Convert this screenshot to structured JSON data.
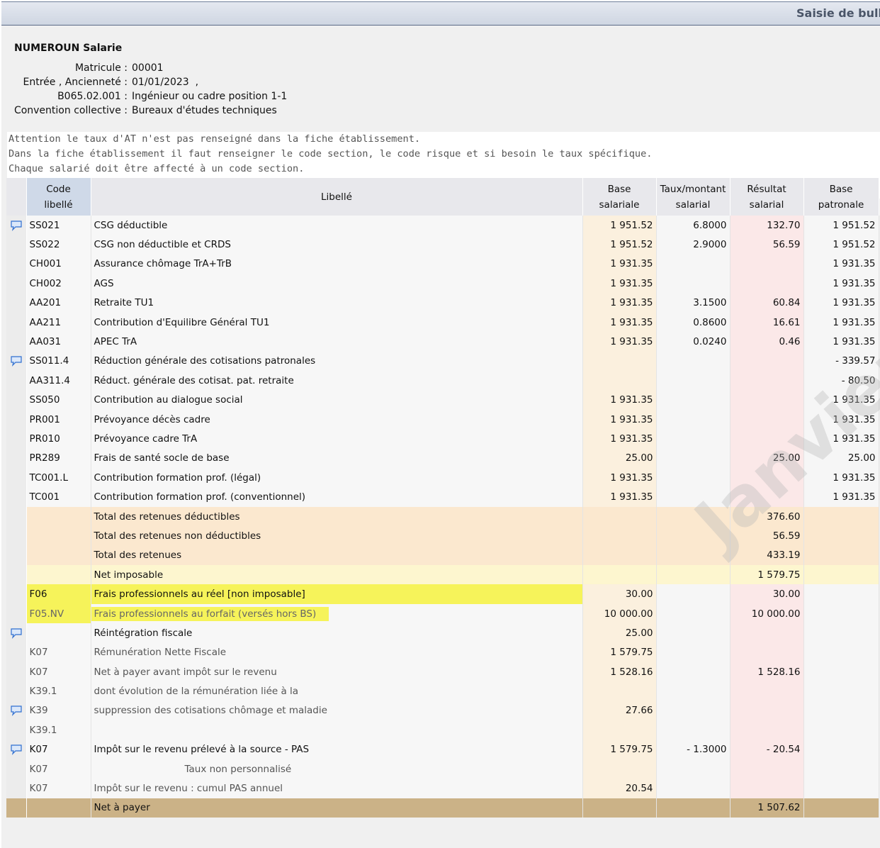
{
  "window": {
    "title": "Saisie de bulletin"
  },
  "employee": {
    "name": "NUMEROUN Salarie",
    "fields": [
      {
        "label": "Matricule :",
        "value": "00001"
      },
      {
        "label": "Entrée , Ancienneté :",
        "value": "01/01/2023  ,"
      },
      {
        "label": "B065.02.001 :",
        "value": "Ingénieur ou cadre position 1-1"
      },
      {
        "label": "Convention collective :",
        "value": "Bureaux d'études techniques"
      }
    ]
  },
  "warning": {
    "lines": [
      "Attention le taux d'AT n'est pas renseigné dans la fiche établissement.",
      "Dans la fiche établissement il faut renseigner le code section, le code risque et si besoin le taux spécifique.",
      "Chaque salarié doit être affecté à un code section."
    ]
  },
  "table": {
    "headers": {
      "code_1": "Code",
      "code_2": "libellé",
      "libelle": "Libellé",
      "base_sal_1": "Base",
      "base_sal_2": "salariale",
      "taux_1": "Taux/montant",
      "taux_2": "salarial",
      "res_1": "Résultat",
      "res_2": "salarial",
      "base_pat_1": "Base",
      "base_pat_2": "patronale"
    },
    "rows": [
      {
        "code": "SS021",
        "label": "CSG déductible",
        "base": "1 951.52",
        "taux": "6.8000",
        "result": "132.70",
        "patr": "1 951.52",
        "comment": true
      },
      {
        "code": "SS022",
        "label": "CSG non déductible et CRDS",
        "base": "1 951.52",
        "taux": "2.9000",
        "result": "56.59",
        "patr": "1 951.52"
      },
      {
        "code": "CH001",
        "label": "Assurance chômage TrA+TrB",
        "base": "1 931.35",
        "taux": "",
        "result": "",
        "patr": "1 931.35"
      },
      {
        "code": "CH002",
        "label": "AGS",
        "base": "1 931.35",
        "taux": "",
        "result": "",
        "patr": "1 931.35"
      },
      {
        "code": "AA201",
        "label": "Retraite TU1",
        "base": "1 931.35",
        "taux": "3.1500",
        "result": "60.84",
        "patr": "1 931.35"
      },
      {
        "code": "AA211",
        "label": "Contribution d'Equilibre Général TU1",
        "base": "1 931.35",
        "taux": "0.8600",
        "result": "16.61",
        "patr": "1 931.35"
      },
      {
        "code": "AA031",
        "label": "APEC TrA",
        "base": "1 931.35",
        "taux": "0.0240",
        "result": "0.46",
        "patr": "1 931.35"
      },
      {
        "code": "SS011.4",
        "label": "Réduction générale des cotisations patronales",
        "base": "",
        "taux": "",
        "result": "",
        "patr": "- 339.57",
        "comment": true
      },
      {
        "code": "AA311.4",
        "label": "Réduct. générale des cotisat. pat. retraite",
        "base": "",
        "taux": "",
        "result": "",
        "patr": "- 80.50"
      },
      {
        "code": "SS050",
        "label": "Contribution au dialogue social",
        "base": "1 931.35",
        "taux": "",
        "result": "",
        "patr": "1 931.35"
      },
      {
        "code": "PR001",
        "label": "Prévoyance décès cadre",
        "base": "1 931.35",
        "taux": "",
        "result": "",
        "patr": "1 931.35"
      },
      {
        "code": "PR010",
        "label": "Prévoyance cadre TrA",
        "base": "1 931.35",
        "taux": "",
        "result": "",
        "patr": "1 931.35"
      },
      {
        "code": "PR289",
        "label": "Frais de santé socle de base",
        "base": "25.00",
        "taux": "",
        "result": "25.00",
        "patr": "25.00"
      },
      {
        "code": "TC001.L",
        "label": "Contribution formation prof. (légal)",
        "base": "1 931.35",
        "taux": "",
        "result": "",
        "patr": "1 931.35"
      },
      {
        "code": "TC001",
        "label": "Contribution formation prof. (conventionnel)",
        "base": "1 931.35",
        "taux": "",
        "result": "",
        "patr": "1 931.35"
      },
      {
        "code": "",
        "label": "Total des retenues déductibles",
        "base": "",
        "taux": "",
        "result": "376.60",
        "patr": "",
        "style": "tot"
      },
      {
        "code": "",
        "label": "Total des retenues non déductibles",
        "base": "",
        "taux": "",
        "result": "56.59",
        "patr": "",
        "style": "tot"
      },
      {
        "code": "",
        "label": "Total des retenues",
        "base": "",
        "taux": "",
        "result": "433.19",
        "patr": "",
        "style": "tot"
      },
      {
        "code": "",
        "label": "Net imposable",
        "base": "",
        "taux": "",
        "result": "1 579.75",
        "patr": "",
        "style": "net"
      },
      {
        "code": "F06",
        "label": "Frais professionnels au réel [non imposable]",
        "base": "30.00",
        "taux": "",
        "result": "30.00",
        "patr": "",
        "style": "hl"
      },
      {
        "code": "F05.NV",
        "label": "Frais professionnels au forfait (versés hors BS)",
        "base": "10 000.00",
        "taux": "",
        "result": "10 000.00",
        "patr": "",
        "style": "hl2"
      },
      {
        "code": "",
        "label": "Réintégration fiscale",
        "base": "25.00",
        "taux": "",
        "result": "",
        "patr": "",
        "comment": true
      },
      {
        "code": "K07",
        "label": "Rémunération Nette Fiscale",
        "base": "1 579.75",
        "taux": "",
        "result": "",
        "patr": "",
        "style": "grey"
      },
      {
        "code": "K07",
        "label": "Net à payer avant impôt sur le revenu",
        "base": "1 528.16",
        "taux": "",
        "result": "1 528.16",
        "patr": "",
        "style": "grey"
      },
      {
        "code": "K39.1",
        "label": "dont évolution de la rémunération liée à la",
        "base": "",
        "taux": "",
        "result": "",
        "patr": "",
        "style": "grey"
      },
      {
        "code": "K39",
        "label": "suppression des cotisations chômage et maladie",
        "base": "27.66",
        "taux": "",
        "result": "",
        "patr": "",
        "style": "grey",
        "comment": true
      },
      {
        "code": "K39.1",
        "label": "",
        "base": "",
        "taux": "",
        "result": "",
        "patr": "",
        "style": "grey"
      },
      {
        "code": "K07",
        "label": "Impôt sur le revenu prélevé à la source - PAS",
        "base": "1 579.75",
        "taux": "- 1.3000",
        "result": "- 20.54",
        "patr": "",
        "comment": true
      },
      {
        "code": "K07",
        "label": "Taux non personnalisé",
        "base": "",
        "taux": "",
        "result": "",
        "patr": "",
        "style": "grey",
        "indent": true
      },
      {
        "code": "K07",
        "label": "Impôt sur le revenu : cumul PAS annuel",
        "base": "20.54",
        "taux": "",
        "result": "",
        "patr": "",
        "style": "grey"
      },
      {
        "code": "",
        "label": "Net à payer",
        "base": "",
        "taux": "",
        "result": "1 507.62",
        "patr": "",
        "style": "final"
      }
    ]
  },
  "watermark": "Janvier",
  "colors": {
    "highlight": "#f6f35a",
    "result_col": "#fbe8e8",
    "base_col": "#fbf0de",
    "net_row": "#cbb287"
  },
  "icons": {
    "comment": "speech-bubble-icon"
  }
}
